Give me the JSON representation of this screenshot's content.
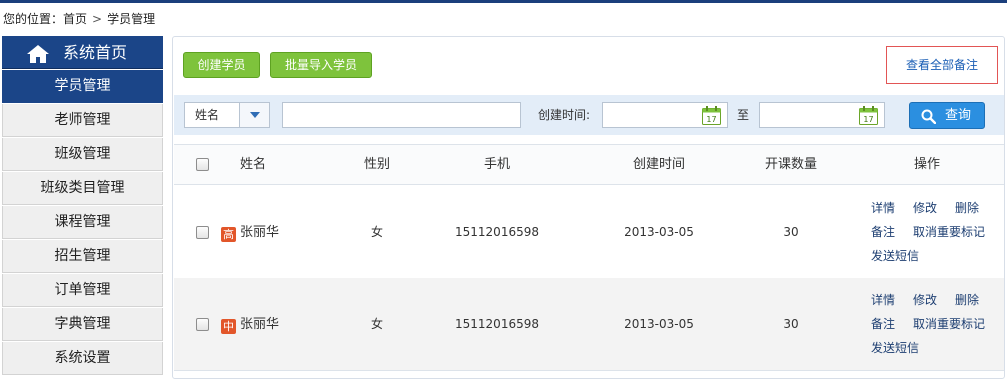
{
  "breadcrumb": {
    "prefix": "您的位置：",
    "home": "首页",
    "separator": ">",
    "current": "学员管理"
  },
  "sidebar": {
    "home_label": "系统首页",
    "items": [
      {
        "label": "学员管理",
        "active": true
      },
      {
        "label": "老师管理",
        "active": false
      },
      {
        "label": "班级管理",
        "active": false
      },
      {
        "label": "班级类目管理",
        "active": false
      },
      {
        "label": "课程管理",
        "active": false
      },
      {
        "label": "招生管理",
        "active": false
      },
      {
        "label": "订单管理",
        "active": false
      },
      {
        "label": "字典管理",
        "active": false
      },
      {
        "label": "系统设置",
        "active": false
      }
    ]
  },
  "toolbar": {
    "create_label": "创建学员",
    "import_label": "批量导入学员",
    "notes_label": "查看全部备注"
  },
  "filter": {
    "field_selected": "姓名",
    "keyword_value": "",
    "created_label": "创建时间:",
    "to_label": "至",
    "date_from": "",
    "date_to": "",
    "calendar_day": "17",
    "search_label": "查询"
  },
  "table": {
    "columns": [
      "姓名",
      "性别",
      "手机",
      "创建时间",
      "开课数量",
      "操作"
    ],
    "rows": [
      {
        "tag": "高",
        "name": "张丽华",
        "gender": "女",
        "phone": "15112016598",
        "created": "2013-03-05",
        "courses": "30",
        "actions": [
          "详情",
          "修改",
          "删除",
          "备注",
          "取消重要标记",
          "发送短信"
        ]
      },
      {
        "tag": "中",
        "name": "张丽华",
        "gender": "女",
        "phone": "15112016598",
        "created": "2013-03-05",
        "courses": "30",
        "actions": [
          "详情",
          "修改",
          "删除",
          "备注",
          "取消重要标记",
          "发送短信"
        ]
      }
    ]
  },
  "colors": {
    "nav_blue": "#1b4588",
    "green_button": "#7ec33c",
    "search_button": "#2b8fe0",
    "tag_orange": "#e2562a",
    "notes_border": "#e25555"
  },
  "icons": {
    "home": "home-icon",
    "dropdown": "chevron-down-icon",
    "calendar": "calendar-icon",
    "search": "search-icon"
  }
}
